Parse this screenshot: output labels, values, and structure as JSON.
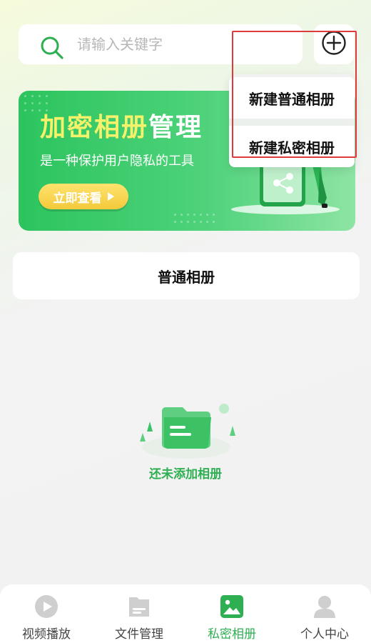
{
  "search": {
    "placeholder": "请输入关键字"
  },
  "banner": {
    "title_highlight": "加密相册",
    "title_rest": "管理",
    "subtitle": "是一种保护用户隐私的工具",
    "button_label": "立即查看"
  },
  "dropdown": {
    "items": [
      {
        "label": "新建普通相册"
      },
      {
        "label": "新建私密相册"
      }
    ]
  },
  "album_tab": {
    "label": "普通相册"
  },
  "empty_state": {
    "text": "还未添加相册"
  },
  "bottom_nav": {
    "items": [
      {
        "label": "视频播放",
        "icon": "play-icon"
      },
      {
        "label": "文件管理",
        "icon": "folder-icon"
      },
      {
        "label": "私密相册",
        "icon": "image-icon",
        "active": true
      },
      {
        "label": "个人中心",
        "icon": "user-icon"
      }
    ]
  },
  "colors": {
    "accent": "#2eaf52",
    "banner_green": "#2cc45e",
    "highlight_red": "#e0393c",
    "title_yellow": "#f4f16a"
  }
}
